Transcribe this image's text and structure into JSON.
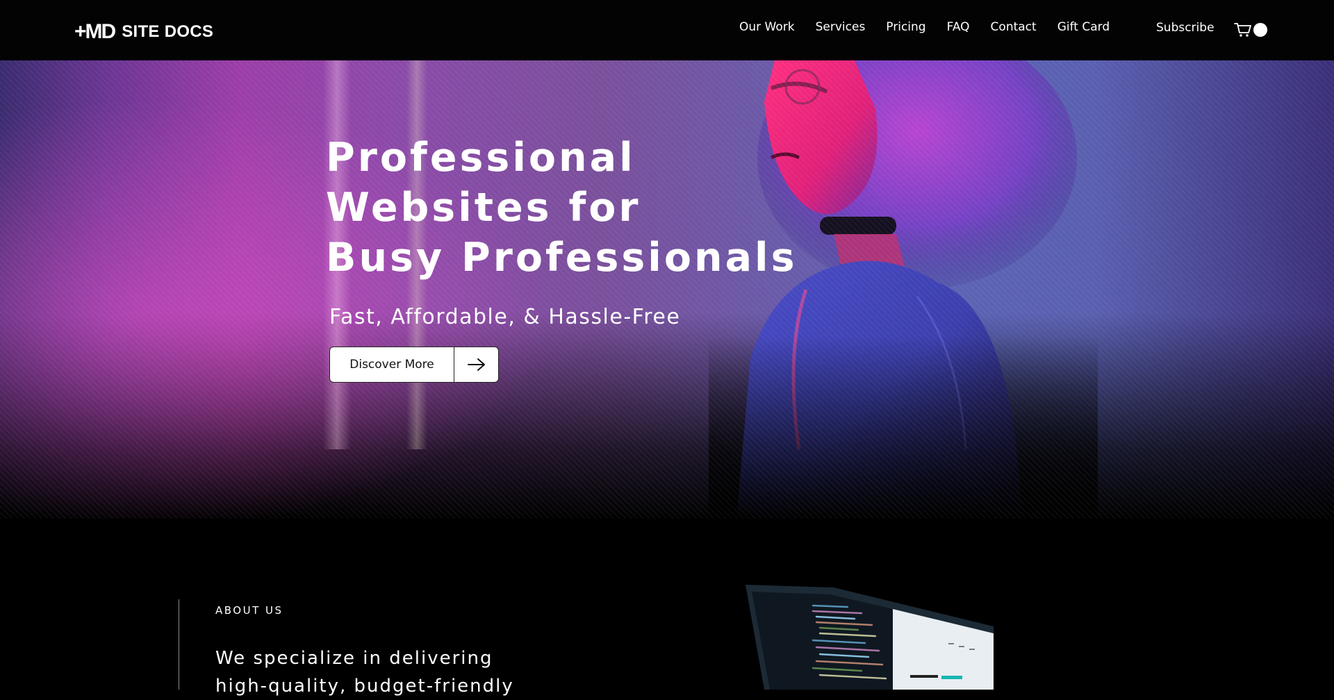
{
  "header": {
    "logo_mark": "+MD",
    "logo_text": "SITE DOCS",
    "nav": [
      {
        "label": "Our Work"
      },
      {
        "label": "Services"
      },
      {
        "label": "Pricing"
      },
      {
        "label": "FAQ"
      },
      {
        "label": "Contact"
      },
      {
        "label": "Gift Card"
      }
    ],
    "subscribe_label": "Subscribe",
    "cart_icon": "cart-icon"
  },
  "hero": {
    "title_lines": [
      "Professional",
      "Websites for",
      "Busy Professionals"
    ],
    "subtitle": "Fast, Affordable, & Hassle-Free",
    "cta_label": "Discover More",
    "cta_icon": "arrow-right-icon"
  },
  "about": {
    "eyebrow": "ABOUT US",
    "text": "We specialize in delivering high-quality, budget-friendly"
  },
  "colors": {
    "header_bg": "#030303",
    "page_bg": "#000000",
    "accent_magenta": "#e63fa0",
    "accent_blue": "#5a5fb0"
  }
}
